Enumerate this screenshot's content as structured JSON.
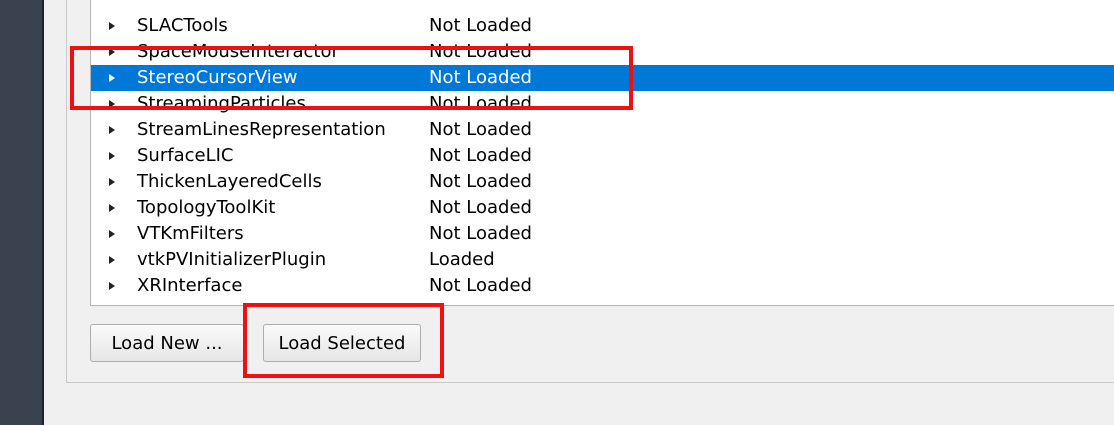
{
  "plugins": [
    {
      "name": "SLACTools",
      "status": "Not Loaded"
    },
    {
      "name": "SpaceMouseInteractor",
      "status": "Not Loaded"
    },
    {
      "name": "StereoCursorView",
      "status": "Not Loaded",
      "selected": true
    },
    {
      "name": "StreamingParticles",
      "status": "Not Loaded"
    },
    {
      "name": "StreamLinesRepresentation",
      "status": "Not Loaded"
    },
    {
      "name": "SurfaceLIC",
      "status": "Not Loaded"
    },
    {
      "name": "ThickenLayeredCells",
      "status": "Not Loaded"
    },
    {
      "name": "TopologyToolKit",
      "status": "Not Loaded"
    },
    {
      "name": "VTKmFilters",
      "status": "Not Loaded"
    },
    {
      "name": "vtkPVInitializerPlugin",
      "status": "Loaded"
    },
    {
      "name": "XRInterface",
      "status": "Not Loaded"
    }
  ],
  "buttons": {
    "load_new": "Load New ...",
    "load_selected": "Load Selected"
  },
  "colors": {
    "selection": "#0078d7",
    "annotation": "#ee1111"
  }
}
